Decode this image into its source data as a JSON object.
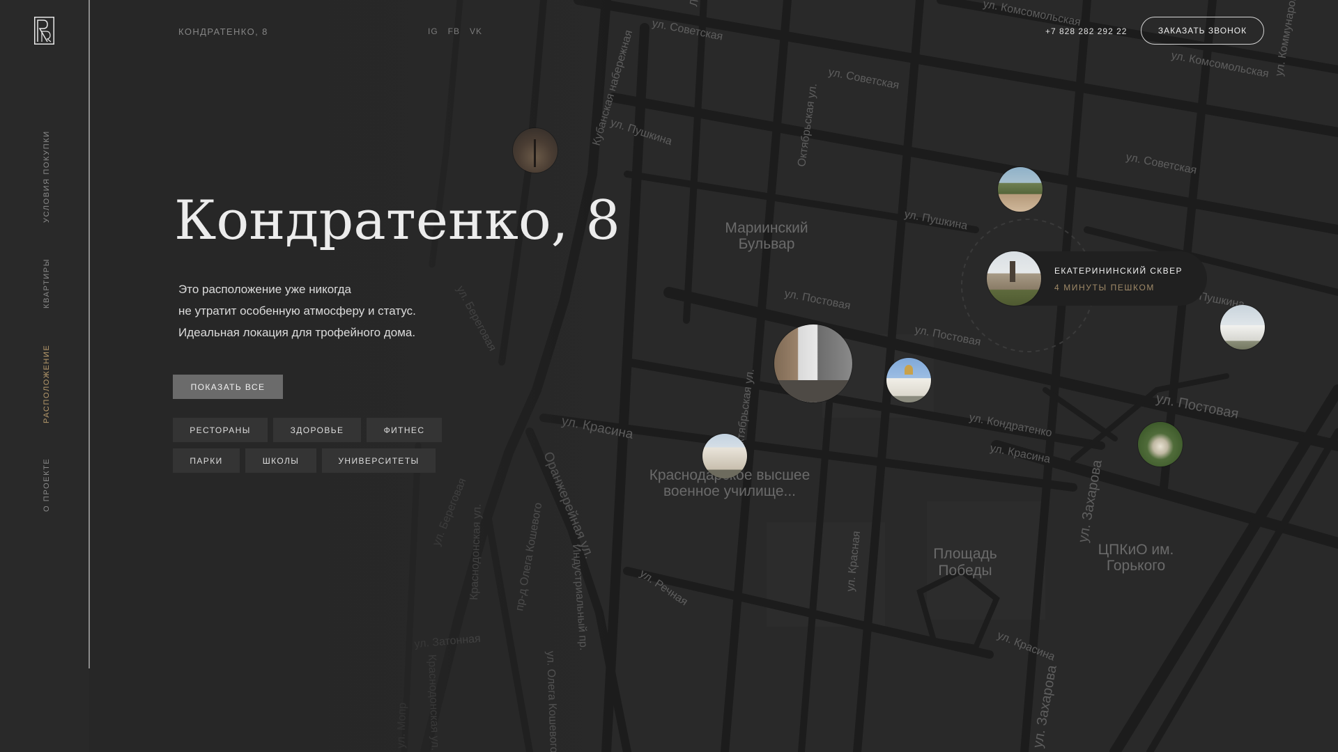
{
  "header": {
    "address": "КОНДРАТЕНКО, 8",
    "social": [
      "IG",
      "FB",
      "VK"
    ],
    "phone": "+7 828 282 292 22",
    "callback_label": "ЗАКАЗАТЬ ЗВОНОК"
  },
  "sidebar": {
    "items": [
      {
        "label": "УСЛОВИЯ ПОКУПКИ",
        "active": false
      },
      {
        "label": "КВАРТИРЫ",
        "active": false
      },
      {
        "label": "РАСПОЛОЖЕНИЕ",
        "active": true
      },
      {
        "label": "О ПРОЕКТЕ",
        "active": false
      }
    ]
  },
  "hero": {
    "title": "Кондратенко, 8",
    "description": [
      "Это расположение уже никогда",
      "не утратит особенную атмосферу и статус.",
      "Идеальная локация для трофейного дома."
    ],
    "show_all_label": "ПОКАЗАТЬ ВСЕ",
    "filters": [
      "РЕСТОРАНЫ",
      "ЗДОРОВЬЕ",
      "ФИТНЕС",
      "ПАРКИ",
      "ШКОЛЫ",
      "УНИВЕРСИТЕТЫ"
    ]
  },
  "map": {
    "streets": [
      "ул. Советская",
      "ул. Советская",
      "ул. Советская",
      "ул. Комсомольская",
      "ул. Комсомольская",
      "Кубанская набережная",
      "ул. Пушкина",
      "ул. Пушкина",
      "Октябрьская ул.",
      "ул. Постовая",
      "ул. Постовая",
      "ул. Постовая",
      "ул. Береговая",
      "ул. Береговая",
      "ул. Красина",
      "ул. Красина",
      "ул. Красина",
      "ул. Кондратенко",
      "Октябрьская ул.",
      "Оранжерейная ул.",
      "Краснодонская ул.",
      "пр-д Олега Кошевого",
      "Индустриальный пр.",
      "ул. Речная",
      "ул. Затонная",
      "ул. Олега Кошевого",
      "ул. Красная",
      "ул. Захарова",
      "ул. Захарова",
      "ул. Мопр",
      "ул. Коммунаров",
      "Краснодонская ул.",
      "Ленина",
      "Пушкина"
    ],
    "areas": [
      [
        "Мариинский",
        "Бульвар"
      ],
      [
        "Краснодарское высшее",
        "военное училище..."
      ],
      [
        "Площадь",
        "Победы"
      ],
      [
        "ЦПКиО им.",
        "Горького"
      ]
    ],
    "featured_poi": {
      "name": "ЕКАТЕРИНИНСКИЙ СКВЕР",
      "walk_time": "4 МИНУТЫ ПЕШКОМ"
    }
  },
  "colors": {
    "background": "#272727",
    "accent_gold": "#b79a6c",
    "road": "#1b1b1b",
    "button_active": "#6b6b6b",
    "button": "#343434"
  },
  "icons": [
    "logo-monogram-icon"
  ]
}
